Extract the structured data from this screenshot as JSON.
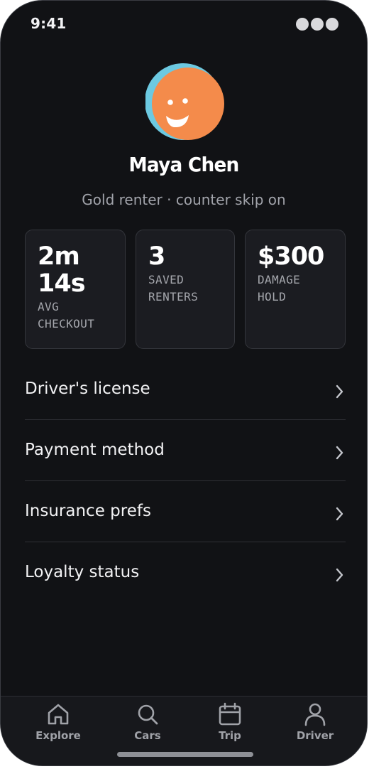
{
  "status_bar": {
    "time": "9:41"
  },
  "profile": {
    "name": "Maya Chen",
    "subtitle": "Gold renter · counter skip on",
    "avatar_colors": {
      "back": "#6cc9e1",
      "front": "#f48b4b",
      "face": "#ffffff"
    }
  },
  "stats": [
    {
      "value": "2m 14s",
      "label": "AVG CHECKOUT"
    },
    {
      "value": "3",
      "label": "SAVED RENTERS"
    },
    {
      "value": "$300",
      "label": "DAMAGE HOLD"
    }
  ],
  "settings": [
    {
      "label": "Driver's license",
      "icon": "chevron-right-icon"
    },
    {
      "label": "Payment method",
      "icon": "chevron-right-icon"
    },
    {
      "label": "Insurance prefs",
      "icon": "chevron-right-icon"
    },
    {
      "label": "Loyalty status",
      "icon": "chevron-right-icon"
    }
  ],
  "tab_bar": {
    "items": [
      {
        "label": "Explore",
        "icon": "home-icon"
      },
      {
        "label": "Cars",
        "icon": "search-icon"
      },
      {
        "label": "Trip",
        "icon": "calendar-icon"
      },
      {
        "label": "Driver",
        "icon": "user-icon"
      }
    ]
  },
  "colors": {
    "background": "#111215",
    "card": "#1b1c21",
    "text_primary": "#ffffff",
    "text_secondary": "#a1a3aa"
  }
}
